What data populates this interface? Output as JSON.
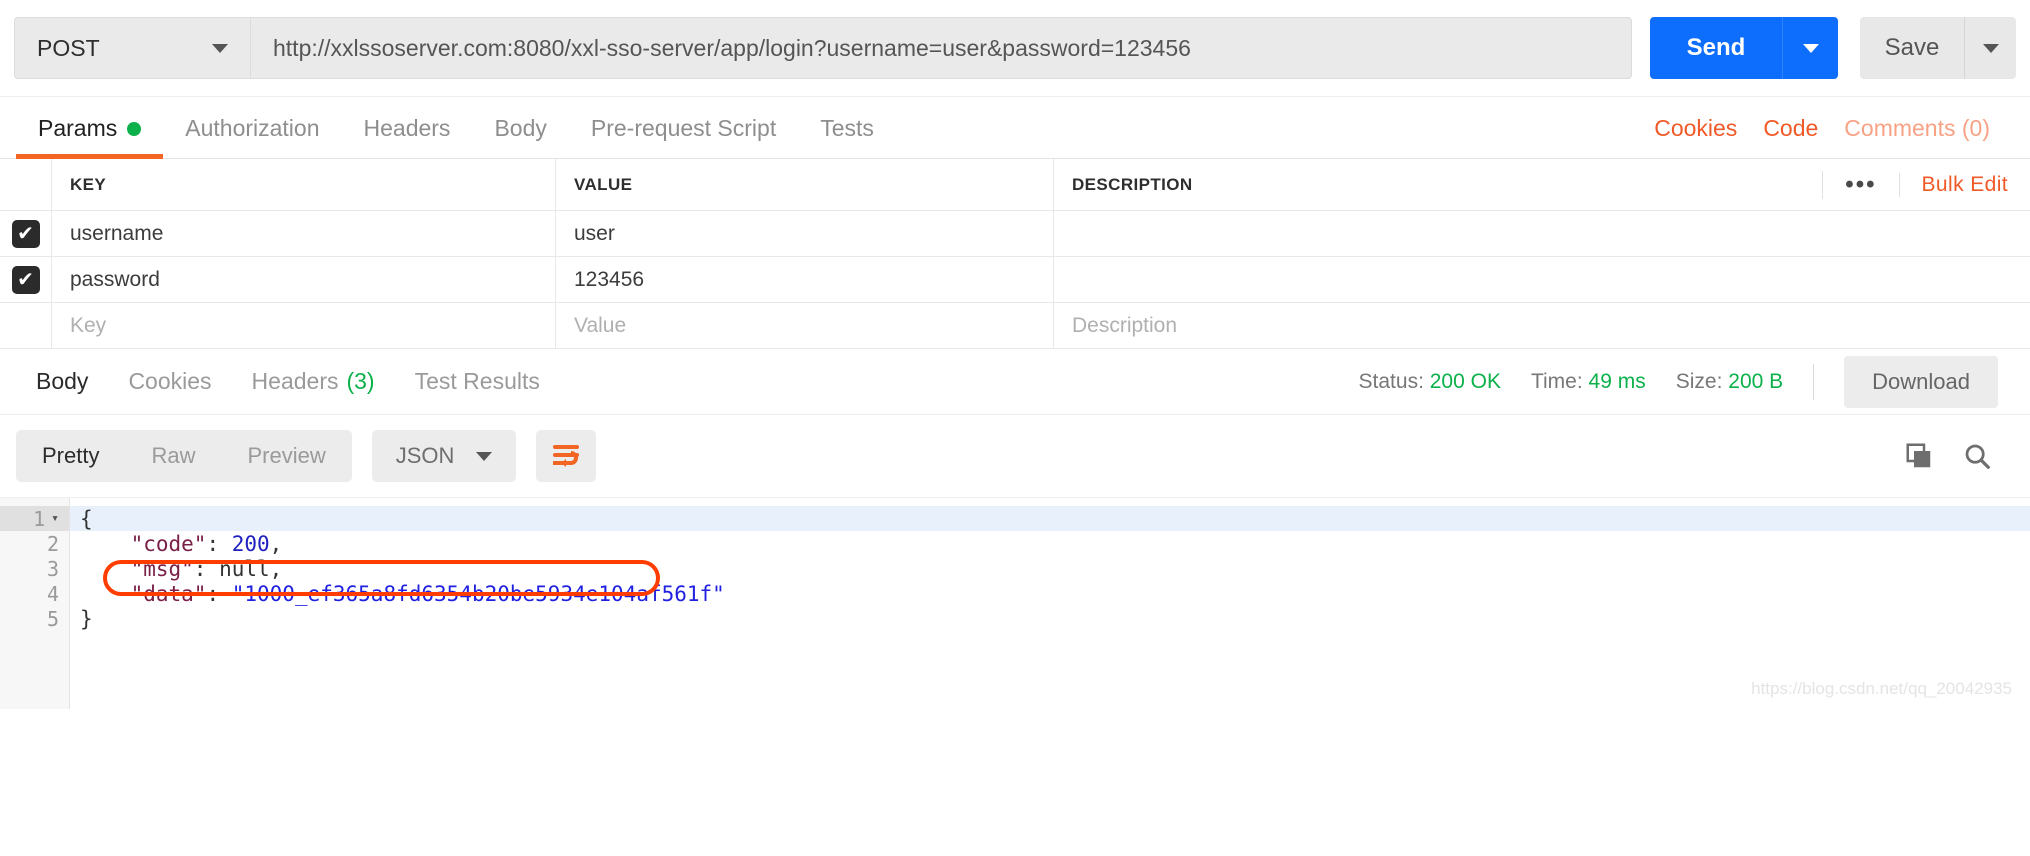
{
  "request": {
    "method": "POST",
    "method_caret_icon": "chevron-down-icon",
    "url": "http://xxlssoserver.com:8080/xxl-sso-server/app/login?username=user&password=123456",
    "send_label": "Send",
    "send_caret_icon": "chevron-down-icon",
    "save_label": "Save",
    "save_caret_icon": "chevron-down-icon",
    "accent_blue": "#0d6efd",
    "accent_orange": "#f26522"
  },
  "request_tabs": {
    "items": [
      {
        "label": "Params",
        "active": true,
        "dot": true
      },
      {
        "label": "Authorization",
        "active": false,
        "dot": false
      },
      {
        "label": "Headers",
        "active": false,
        "dot": false
      },
      {
        "label": "Body",
        "active": false,
        "dot": false
      },
      {
        "label": "Pre-request Script",
        "active": false,
        "dot": false
      },
      {
        "label": "Tests",
        "active": false,
        "dot": false
      }
    ],
    "right_links": [
      {
        "label": "Cookies",
        "muted": false
      },
      {
        "label": "Code",
        "muted": false
      },
      {
        "label": "Comments (0)",
        "muted": true
      }
    ]
  },
  "params_table": {
    "headers": {
      "key": "KEY",
      "value": "VALUE",
      "description": "DESCRIPTION"
    },
    "options_icon": "ellipsis-icon",
    "bulk_edit_label": "Bulk Edit",
    "rows": [
      {
        "checked": true,
        "key": "username",
        "value": "user",
        "description": ""
      },
      {
        "checked": true,
        "key": "password",
        "value": "123456",
        "description": ""
      }
    ],
    "placeholder_row": {
      "key": "Key",
      "value": "Value",
      "description": "Description"
    },
    "check_glyph": "✔"
  },
  "response_tabs": {
    "items": [
      {
        "label": "Body",
        "count": "",
        "active": true
      },
      {
        "label": "Cookies",
        "count": "",
        "active": false
      },
      {
        "label": "Headers",
        "count": "(3)",
        "active": false
      },
      {
        "label": "Test Results",
        "count": "",
        "active": false
      }
    ],
    "meta": {
      "status_label": "Status:",
      "status_value": "200 OK",
      "time_label": "Time:",
      "time_value": "49 ms",
      "size_label": "Size:",
      "size_value": "200 B",
      "status_color": "#0cb14b"
    },
    "download_label": "Download"
  },
  "body_toolbar": {
    "views": [
      {
        "label": "Pretty",
        "active": true
      },
      {
        "label": "Raw",
        "active": false
      },
      {
        "label": "Preview",
        "active": false
      }
    ],
    "format": "JSON",
    "format_caret_icon": "chevron-down-icon",
    "wrap_icon": "word-wrap-icon",
    "copy_icon": "copy-icon",
    "search_icon": "search-icon"
  },
  "response_body": {
    "language": "json",
    "line_numbers": [
      "1",
      "2",
      "3",
      "4",
      "5"
    ],
    "lines": [
      {
        "n": "1",
        "text": "{",
        "foldable": true
      },
      {
        "n": "2",
        "text": "    \"code\": 200,",
        "foldable": false
      },
      {
        "n": "3",
        "text": "    \"msg\": null,",
        "foldable": false
      },
      {
        "n": "4",
        "text": "    \"data\": \"1000_ef365a8fd6354b20be5934e104af561f\"",
        "foldable": false
      },
      {
        "n": "5",
        "text": "}",
        "foldable": false
      }
    ],
    "tokens": {
      "l1": "{",
      "l2_key": "\"code\"",
      "l2_val": "200",
      "l3_key": "\"msg\"",
      "l3_val": "null",
      "l4_key": "\"data\"",
      "l4_val": "\"1000_ef365a8fd6354b20be5934e104af561f\"",
      "l5": "}",
      "colon": ": ",
      "comma": ","
    },
    "highlight_color": "#ff3d00"
  },
  "watermark": "https://blog.csdn.net/qq_20042935"
}
